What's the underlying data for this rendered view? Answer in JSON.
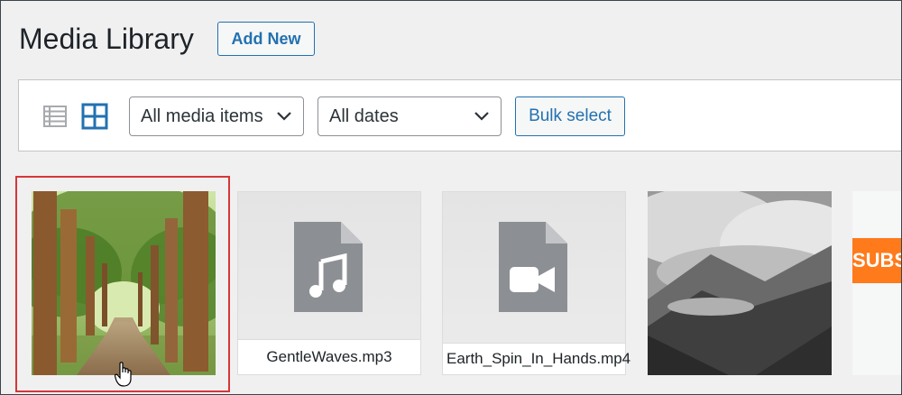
{
  "header": {
    "title": "Media Library",
    "add_new_label": "Add New"
  },
  "toolbar": {
    "view_modes": [
      "list-view-icon",
      "grid-view-icon"
    ],
    "active_view": "grid",
    "filter_type": {
      "selected": "All media items"
    },
    "filter_date": {
      "selected": "All dates"
    },
    "bulk_select_label": "Bulk select"
  },
  "media_items": [
    {
      "kind": "image",
      "subject": "forest path with trees",
      "selected": true
    },
    {
      "kind": "audio",
      "filename": "GentleWaves.mp3"
    },
    {
      "kind": "video",
      "filename": "Earth_Spin_In_Hands.mp4"
    },
    {
      "kind": "image",
      "subject": "black and white mountain lake"
    },
    {
      "kind": "image",
      "subject": "orange subscribe banner",
      "visible_text": "SUBSC"
    }
  ],
  "colors": {
    "accent": "#2271b1",
    "selection_outline": "#d63638",
    "file_icon": "#8c8f94",
    "subscribe_orange": "#ff7a1a"
  }
}
